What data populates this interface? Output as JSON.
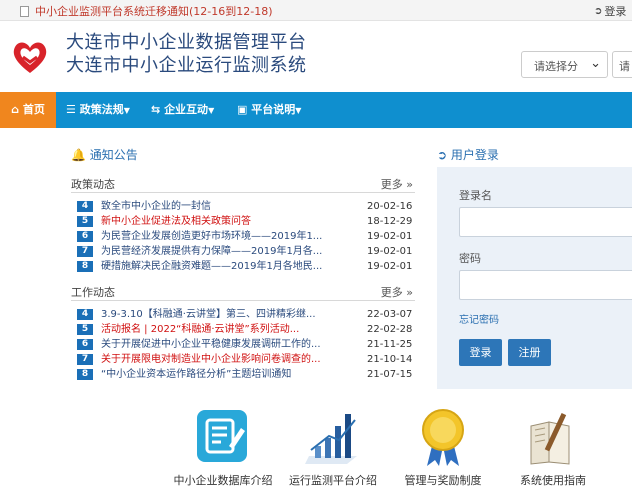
{
  "topbar": {
    "notice": "中小企业监测平台系统迁移通知(12-16到12-18)",
    "login": "登录"
  },
  "header": {
    "title_line1": "大连市中小企业数据管理平台",
    "title_line2": "大连市中小企业运行监测系统",
    "select_value": "请选择分",
    "search_placeholder": "请"
  },
  "nav": {
    "home": "首页",
    "items": [
      "政策法规",
      "企业互动",
      "平台说明"
    ]
  },
  "notice": {
    "title": "通知公告",
    "policy": {
      "heading": "政策动态",
      "more": "更多",
      "rows": [
        {
          "num": "4",
          "text": "致全市中小企业的一封信",
          "date": "20-02-16",
          "red": false
        },
        {
          "num": "5",
          "text": "新中小企业促进法及相关政策问答",
          "date": "18-12-29",
          "red": true
        },
        {
          "num": "6",
          "text": "为民营企业发展创造更好市场环境——2019年1...",
          "date": "19-02-01",
          "red": false
        },
        {
          "num": "7",
          "text": "为民营经济发展提供有力保障——2019年1月各...",
          "date": "19-02-01",
          "red": false
        },
        {
          "num": "8",
          "text": "硬措施解决民企融资难题——2019年1月各地民...",
          "date": "19-02-01",
          "red": false
        }
      ]
    },
    "work": {
      "heading": "工作动态",
      "more": "更多",
      "rows": [
        {
          "num": "4",
          "text": "3.9-3.10【科融通·云讲堂】第三、四讲精彩继...",
          "date": "22-03-07",
          "red": false
        },
        {
          "num": "5",
          "text": "活动报名 | 2022“科融通·云讲堂”系列活动...",
          "date": "22-02-28",
          "red": true
        },
        {
          "num": "6",
          "text": "关于开展促进中小企业平稳健康发展调研工作的...",
          "date": "21-11-25",
          "red": false
        },
        {
          "num": "7",
          "text": "关于开展限电对制造业中小企业影响问卷调查的...",
          "date": "21-10-14",
          "red": true
        },
        {
          "num": "8",
          "text": "“中小企业资本运作路径分析”主题培训通知",
          "date": "21-07-15",
          "red": false
        }
      ]
    }
  },
  "login_panel": {
    "title": "用户登录",
    "username_label": "登录名",
    "password_label": "密码",
    "forgot": "忘记密码",
    "login_button": "登录",
    "register_button": "注册"
  },
  "bottom_links": [
    {
      "label": "中小企业数据库介绍",
      "icon": "database-icon"
    },
    {
      "label": "运行监测平台介绍",
      "icon": "chart-icon"
    },
    {
      "label": "管理与奖励制度",
      "icon": "medal-icon"
    },
    {
      "label": "系统使用指南",
      "icon": "book-icon"
    }
  ],
  "colors": {
    "nav_bg": "#0f8fcf",
    "home_bg": "#f0861e",
    "title_blue": "#2a4a7d",
    "badge_blue": "#1a6fb7",
    "alert_red": "#d01010"
  }
}
